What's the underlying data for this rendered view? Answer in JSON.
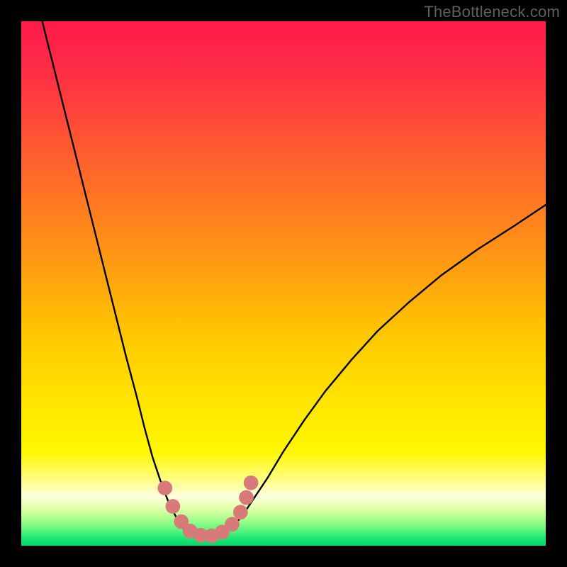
{
  "watermark": "TheBottleneck.com",
  "colors": {
    "frame_bg": "#000000",
    "curve_stroke": "#000000",
    "marker_fill": "#d97a7a",
    "watermark_color": "#5f5f5f"
  },
  "chart_data": {
    "type": "line",
    "title": "",
    "xlabel": "",
    "ylabel": "",
    "xlim": [
      0,
      100
    ],
    "ylim": [
      0,
      100
    ],
    "grid": false,
    "background_gradient_stops": [
      {
        "offset": 0.0,
        "color": "#ff1a4b"
      },
      {
        "offset": 0.1,
        "color": "#ff2e45"
      },
      {
        "offset": 0.22,
        "color": "#ff5334"
      },
      {
        "offset": 0.35,
        "color": "#ff7a22"
      },
      {
        "offset": 0.48,
        "color": "#ffa010"
      },
      {
        "offset": 0.6,
        "color": "#ffc800"
      },
      {
        "offset": 0.72,
        "color": "#ffe400"
      },
      {
        "offset": 0.82,
        "color": "#fff700"
      },
      {
        "offset": 0.885,
        "color": "#ffffa0"
      },
      {
        "offset": 0.905,
        "color": "#ffffe0"
      },
      {
        "offset": 0.925,
        "color": "#e8ffb0"
      },
      {
        "offset": 0.945,
        "color": "#b8ff90"
      },
      {
        "offset": 0.965,
        "color": "#70f880"
      },
      {
        "offset": 0.985,
        "color": "#22e878"
      },
      {
        "offset": 1.0,
        "color": "#00d868"
      }
    ],
    "series": [
      {
        "name": "bottleneck-left",
        "x": [
          4,
          6,
          8,
          10,
          12,
          14,
          16,
          18,
          20,
          22,
          23.5,
          25,
          26.5,
          28,
          29.5,
          31
        ],
        "y": [
          100,
          92,
          84,
          76,
          68,
          60,
          52,
          44,
          36,
          28.5,
          22.5,
          17,
          12.5,
          8.5,
          5.5,
          3.2
        ]
      },
      {
        "name": "bottleneck-bottom",
        "x": [
          31,
          32.5,
          34,
          35.5,
          37,
          38.5,
          40
        ],
        "y": [
          3.2,
          2.3,
          1.8,
          1.7,
          1.9,
          2.4,
          3.4
        ]
      },
      {
        "name": "bottleneck-right",
        "x": [
          40,
          42,
          44,
          47,
          50,
          54,
          58,
          63,
          68,
          74,
          80,
          87,
          94,
          100
        ],
        "y": [
          3.4,
          5.5,
          8.5,
          13,
          18,
          24,
          29.5,
          35.5,
          41,
          46.5,
          51.5,
          56.5,
          61,
          65
        ]
      }
    ],
    "markers": {
      "name": "sweet-spot-points",
      "radius_percent": 1.4,
      "points": [
        {
          "x": 27.4,
          "y": 11.0
        },
        {
          "x": 28.9,
          "y": 7.5
        },
        {
          "x": 30.5,
          "y": 4.6
        },
        {
          "x": 32.2,
          "y": 2.8
        },
        {
          "x": 34.2,
          "y": 2.0
        },
        {
          "x": 36.3,
          "y": 1.9
        },
        {
          "x": 38.3,
          "y": 2.6
        },
        {
          "x": 40.2,
          "y": 4.1
        },
        {
          "x": 41.8,
          "y": 6.4
        },
        {
          "x": 42.9,
          "y": 9.2
        },
        {
          "x": 43.8,
          "y": 12.0
        }
      ]
    }
  }
}
